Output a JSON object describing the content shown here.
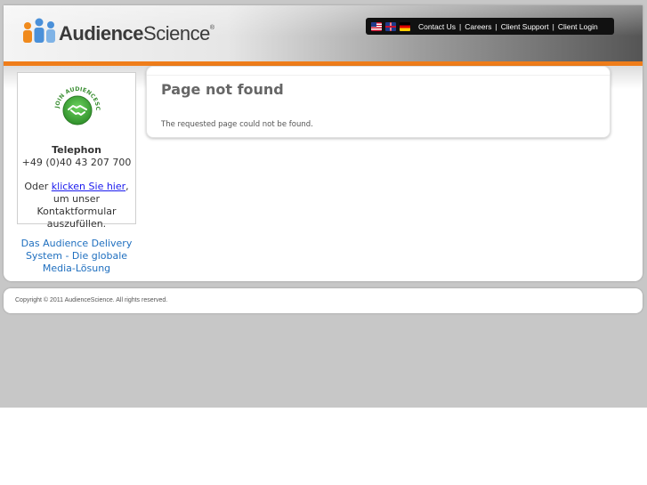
{
  "header": {
    "logo": {
      "bold": "Audience",
      "light": "Science",
      "mark": "®"
    },
    "nav": {
      "flags": [
        "us-flag-icon",
        "uk-flag-icon",
        "de-flag-icon"
      ],
      "links": [
        "Contact Us",
        "Careers",
        "Client Support",
        "Client Login"
      ],
      "separator": "|"
    }
  },
  "sidebar": {
    "badge": {
      "ring_text": "JOIN AUDIENCESCIENCE",
      "icon": "handshake-icon"
    },
    "telephone_label": "Telephon",
    "telephone_number": "+49 (0)40 43 207 700",
    "contact_prefix": "Oder ",
    "contact_link": "klicken Sie hier",
    "contact_suffix": ", um unser Kontaktformular auszufüllen.",
    "promo": "Das Audience Delivery System - Die globale Media-Lösung"
  },
  "content": {
    "title": "Page not found",
    "message": "The requested page could not be found."
  },
  "footer": {
    "copyright": "Copyright © 2011 AudienceScience. All rights reserved."
  },
  "colors": {
    "accent_orange": "#ef7d1a",
    "badge_green": "#3fa83a",
    "promo_blue": "#1f6fbf",
    "link_blue": "#1a1aee"
  }
}
